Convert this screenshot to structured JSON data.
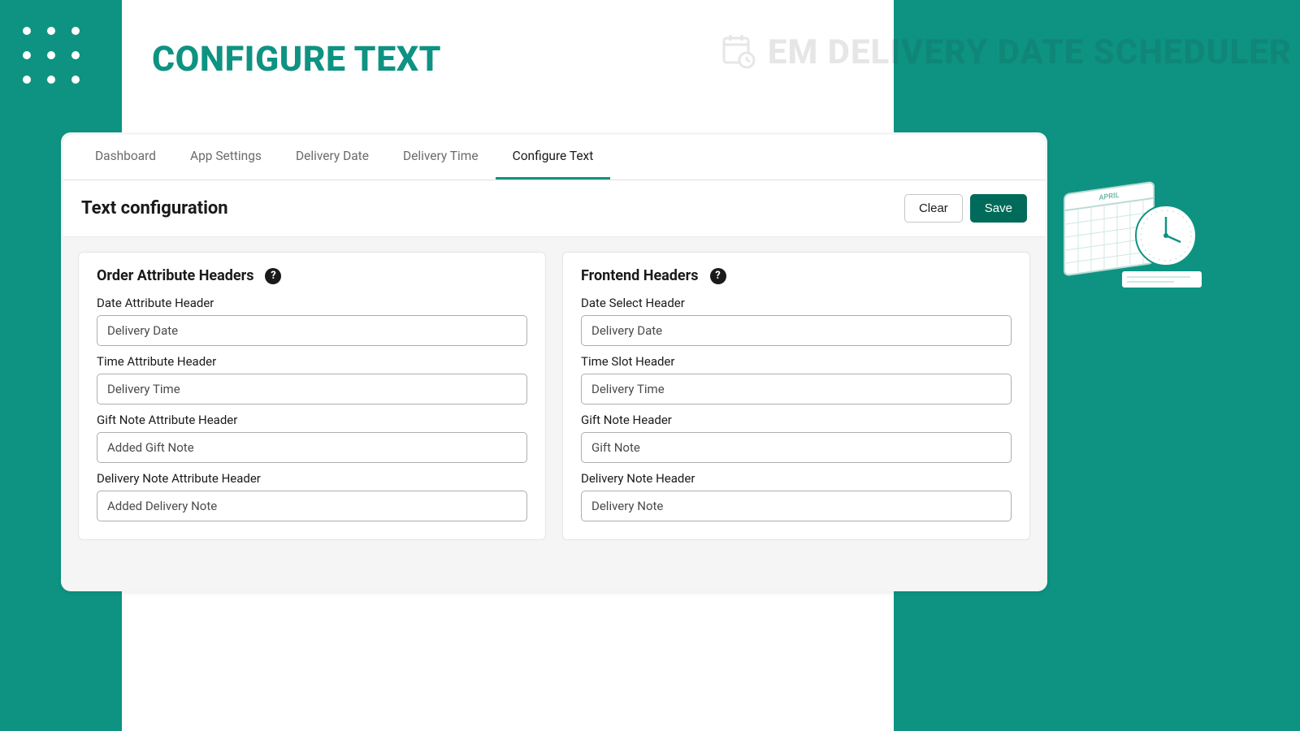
{
  "page_title": "CONFIGURE TEXT",
  "brand": "EM DELIVERY DATE SCHEDULER",
  "tabs": {
    "items": [
      "Dashboard",
      "App Settings",
      "Delivery Date",
      "Delivery Time",
      "Configure Text"
    ],
    "active_index": 4
  },
  "section": {
    "title": "Text configuration",
    "clear": "Clear",
    "save": "Save"
  },
  "card_left": {
    "title": "Order Attribute Headers",
    "fields": [
      {
        "label": "Date Attribute Header",
        "value": "Delivery Date"
      },
      {
        "label": "Time Attribute Header",
        "value": "Delivery Time"
      },
      {
        "label": "Gift Note Attribute Header",
        "value": "Added Gift Note"
      },
      {
        "label": "Delivery Note Attribute Header",
        "value": "Added Delivery Note"
      }
    ]
  },
  "card_right": {
    "title": "Frontend Headers",
    "fields": [
      {
        "label": "Date Select Header",
        "value": "Delivery Date"
      },
      {
        "label": "Time Slot Header",
        "value": "Delivery Time"
      },
      {
        "label": "Gift Note Header",
        "value": "Gift Note"
      },
      {
        "label": "Delivery Note Header",
        "value": "Delivery Note"
      }
    ]
  }
}
